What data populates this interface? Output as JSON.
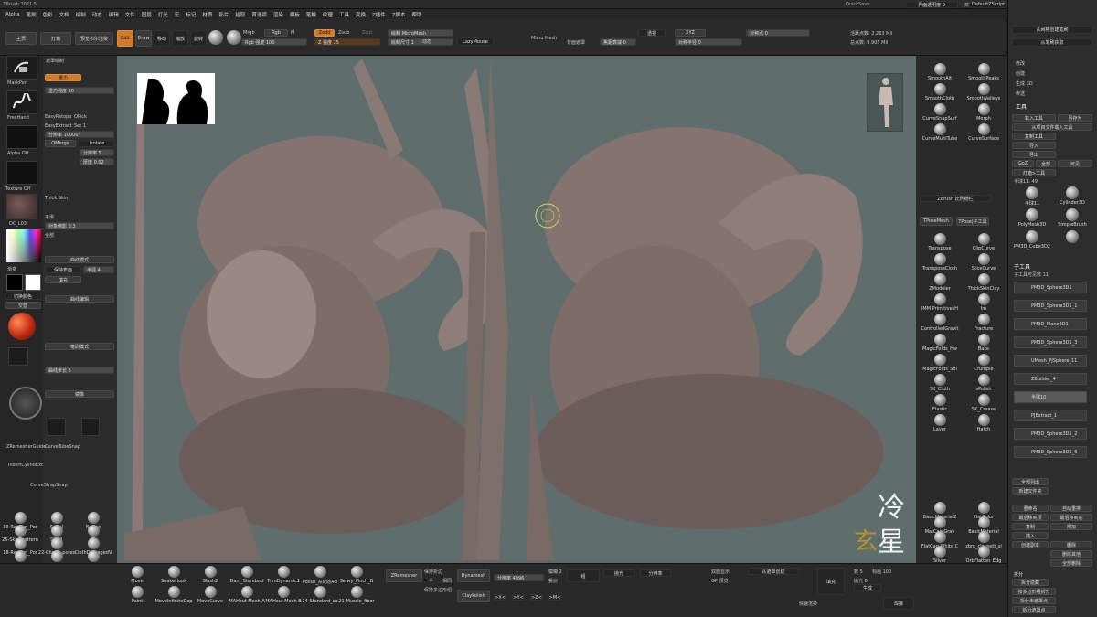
{
  "app": {
    "title": "ZBrush 2021.5",
    "coords": "0.286, -0.344,0.998",
    "quicksave": "QuickSave",
    "ui_opacity": "界面透明度 0",
    "menus_label": "菜单",
    "default_script": "DefaultZScript"
  },
  "menubar": [
    "Alpha",
    "笔刷",
    "色彩",
    "文档",
    "绘制",
    "动态",
    "编辑",
    "文件",
    "图层",
    "灯光",
    "宏",
    "标记",
    "材质",
    "影片",
    "拾取",
    "首选项",
    "渲染",
    "模板",
    "笔触",
    "纹理",
    "工具",
    "变换",
    "Z插件",
    "Z脚本",
    "帮助"
  ],
  "shelf": {
    "home": "主页",
    "lightbox": "灯箱",
    "boolean": "预览布尔渲染",
    "edit": "Edit",
    "draw": "Draw",
    "move": "移动",
    "scale": "缩放",
    "rotate": "旋转",
    "mrgb": "Mrgb",
    "rgb": "Rgb",
    "m": "M",
    "rgb_intensity": "Rgb 强度 100",
    "zadd": "Zadd",
    "zsub": "Zsub",
    "zcut": "Zcut",
    "z_intensity": "Z 强度 25",
    "draw_size": "绘制 MicroMesh",
    "focal": "焦距衰减 0",
    "draw_size2": "绘制尺寸 1",
    "dynamic": "动态",
    "lazymouse": "LazyMouse",
    "micromesh": "Micro Mesh",
    "backface": "背面遮罩",
    "persp": "透视",
    "active_points": "活跃点数: 2.263 Mil",
    "total_points": "总点数: 9.905 Mil",
    "sym_radius": "对称半径 0",
    "sym_point": "对称点 0",
    "xyz": "XYZ"
  },
  "left_tools": {
    "maskpen": "MaskPen",
    "freehand": "FreeHand",
    "alpha_off": "Alpha Off",
    "texture_off": "Texture Off",
    "dc_lo3": "DC_L03",
    "gradient": "渐变",
    "switch_color": "切换颜色",
    "alternate": "交替"
  },
  "left_panel2": {
    "title": "遮罩绘制",
    "gravity": "重力",
    "gravity_strength": "重力强度 10",
    "easyretopo": "EasyRetopo",
    "qpick": "QPick",
    "easyextract": "EasyExtract",
    "set1": "Set 1",
    "density": "分辨率 10000",
    "qmerge": "QMerge",
    "isolate": "Isolate",
    "resolution": "分辨率 5",
    "thickness": "厚度 0.02",
    "thick_skin": "Thick Skin",
    "smooth": "平滑",
    "brush_col1": "缩放",
    "brush_col2": "对象倒影 0.3",
    "sides": "全部",
    "curve_mode": "曲线模式",
    "keep_surface": "保持表面",
    "radius": "半径 4",
    "fill": "填充",
    "curve": "曲线编辑",
    "brush_mode": "笔刷模式",
    "curve_steps": "曲线步长 5",
    "mirror": "镜像",
    "remesh": "ZRemesherGuide",
    "curvetubesnap": "CurveTubeSnap",
    "insertcyl": "InsertCylindExt",
    "curvestrapsnap": "CurveStrapSnap"
  },
  "left_brushes": [
    {
      "name": "19-Randon_Por"
    },
    {
      "name": "Spiral"
    },
    {
      "name": "Nudge"
    },
    {
      "name": "25-Skin_pattern"
    },
    {
      "name": "Skin1"
    },
    {
      "name": ""
    },
    {
      "name": "18-Randon_Por"
    },
    {
      "name": "22-Cheek_pores"
    },
    {
      "name": "ClothDamagedV"
    },
    {
      "name": "Blob"
    },
    {
      "name": "ClayTubes"
    },
    {
      "name": "ClayPolish"
    }
  ],
  "right_brushes": [
    {
      "name": "SmoothAlt"
    },
    {
      "name": "SmoothPeaks"
    },
    {
      "name": "SmoothCloth"
    },
    {
      "name": "SmoothValleys"
    },
    {
      "name": "CurveSnapSurf"
    },
    {
      "name": "Morph"
    },
    {
      "name": "CurveMultiTube"
    },
    {
      "name": "CurveSurface"
    }
  ],
  "right_panel": {
    "zbrush_tool": "ZBrush 比例栅栏",
    "tpose": "TPoseMesh",
    "tpose_sub": "TPose|子工具",
    "transpose": "Transpose",
    "clipcurve": "ClipCurve",
    "transposecloth": "TransposeCloth",
    "slicecurve": "SliceCurve",
    "zmodeler": "ZModeler",
    "thickskinclay": "ThickSkinClay",
    "imm": "IMM PrimitivesH",
    "im": "Im",
    "controlledgravity": "ControlledGravit",
    "fracture": "Fracture",
    "magicfolds_hw": "MagicFolds_Hw",
    "bake": "Bake",
    "magicfolds_sol": "MagicFolds_Sol",
    "crumple": "Crumple",
    "sk_cloth": "SK_Cloth",
    "spolish": "sPolish",
    "elastic": "Elastic",
    "sk_crease": "SK_Crease",
    "layer": "Layer",
    "hatch": "Hatch",
    "split": "拆分",
    "uv": "Uv",
    "new_uv": "创建 UV",
    "sel_fill": "选择填充",
    "basicmaterial2": "BasicMaterial2",
    "flatcolor": "FlatColor",
    "matcapgray": "MatCap Gray",
    "basicmaterial": "BasicMaterial",
    "flatcapwhite": "FlatCap White C",
    "zbro": "zbro_claysett_sl",
    "silver": "Silver",
    "orbflatten": "OrbFlatten_Edg"
  },
  "far_right": {
    "header1": "从网格创建笔刷",
    "header2": "从笔刷获取",
    "modify": "修改",
    "create": "创建",
    "gen3d": "生成 3D",
    "transfer": "传送",
    "tool_title": "工具",
    "load_tool": "载入工具",
    "save_as": "另存为",
    "load_proj": "从项目文件载入工具",
    "copy_tool": "复制工具",
    "import": "导入",
    "export": "导出",
    "goz": "GoZ",
    "all": "全部",
    "visible": "可见",
    "lightbox_tool": "灯箱>工具",
    "current_tool": "半球11. 49",
    "tools": [
      "半球11",
      "Cylinder3D",
      "PolyMesh3D",
      "SimpleBrush",
      "PM3D_Cube3D2",
      ""
    ],
    "subtool_title": "子工具",
    "subtool_count": "子工具可见数 11",
    "subtools": [
      "PM3D_Sphere3D1",
      "PM3D_Sphere3D1_1",
      "PM3D_Plane3D1",
      "PM3D_Sphere3D1_3",
      "UMesh_PJSphere_11",
      "ZBuilder_4",
      "半球10",
      "PJExtract_1",
      "PM3D_Sphere3D1_2",
      "PM3D_Sphere3D1_6"
    ],
    "list_all": "全部列出",
    "new_folder": "新建文件夹",
    "rename": "重命名",
    "autoorder": "自动重排",
    "all_up": "最后移到顶",
    "all_down": "最后移到底",
    "duplicate": "复制",
    "append": "附加",
    "insert": "插入",
    "create_copy": "创建副本",
    "delete": "删除",
    "del_other": "删除其他",
    "del_all": "全部删除",
    "split_title": "拆分",
    "split_hidden": "拆分隐藏",
    "groups_split": "按多边形组拆分",
    "split_unmasked": "拆分未遮罩点",
    "split_masked": "拆分遮罩点",
    "merge": "合并"
  },
  "bottom_brushes": [
    {
      "name": "Move"
    },
    {
      "name": "SnakeHook"
    },
    {
      "name": "Slash2"
    },
    {
      "name": "Dam_Standard"
    },
    {
      "name": "TrimDynamic1"
    },
    {
      "name": "Polish_从动态48"
    },
    {
      "name": "Selwy_Pinch_B"
    },
    {
      "name": "Paint"
    },
    {
      "name": "MoveInfiniteDep"
    },
    {
      "name": "MoveCurve"
    },
    {
      "name": "MAHcut Mech A"
    },
    {
      "name": "MAHcut Mech B"
    },
    {
      "name": "24-Standard_ca"
    },
    {
      "name": "21-Muscle_fiber"
    }
  ],
  "bottom": {
    "zremesher": "ZRemesher",
    "keep_groups": "保持折边",
    "one": "一半",
    "same": "相同",
    "keep_poly": "保持多边形组",
    "dynamesh": "Dynamesh",
    "resolution": "分辨率 4096",
    "claypolish": "ClayPolish",
    "smooth_group": "模",
    "blur": "模糊 2",
    "project": "投射",
    "group": "组",
    "polish": "抛光",
    "subdiv": "分辨率",
    "x": ">X<",
    "y": ">Y<",
    "z": ">Z<",
    "m": ">M<",
    "double": "双面显示",
    "gp": "GP 预览",
    "mask_target": "从遮罩创建",
    "fill": "填充",
    "count": "数 5",
    "size": "标画 100",
    "polish_val": "抛光 0",
    "gen": "生成",
    "quick": "快速渲染",
    "weld": "焊接"
  },
  "watermark": {
    "line1": "冷",
    "line2": "星",
    "seal": "玄"
  }
}
